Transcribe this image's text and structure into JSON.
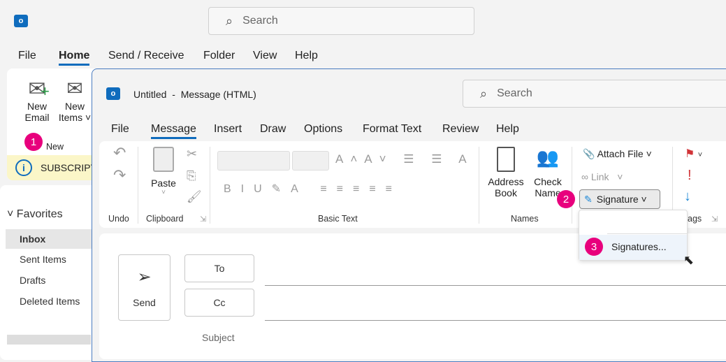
{
  "main": {
    "search_placeholder": "Search",
    "menu": [
      "File",
      "Home",
      "Send / Receive",
      "Folder",
      "View",
      "Help"
    ],
    "ribbon": {
      "new_email": [
        "New",
        "Email"
      ],
      "new_items": [
        "New",
        "Items"
      ],
      "group_new": "New",
      "banner": "SUBSCRIPT"
    },
    "nav": {
      "favorites": "Favorites",
      "items": [
        "Inbox",
        "Sent Items",
        "Drafts",
        "Deleted Items"
      ]
    }
  },
  "compose": {
    "title": "Untitled  -  Message (HTML)",
    "search_placeholder": "Search",
    "tabs": [
      "File",
      "Message",
      "Insert",
      "Draw",
      "Options",
      "Format Text",
      "Review",
      "Help"
    ],
    "active_tab": "Message",
    "groups": {
      "undo": "Undo",
      "clipboard": "Clipboard",
      "basic_text": "Basic Text",
      "names": "Names",
      "tags": "ags"
    },
    "paste": "Paste",
    "address_book": [
      "Address",
      "Book"
    ],
    "check_names": [
      "Check",
      "Name"
    ],
    "attach_file": "Attach File",
    "link": "Link",
    "signature": "Signature",
    "signatures_item": "Signatures...",
    "send": "Send",
    "to": "To",
    "cc": "Cc",
    "subject": "Subject"
  },
  "badges": [
    "1",
    "2",
    "3"
  ],
  "colors": {
    "accent": "#0f6cbd",
    "badge": "#e8007d",
    "banner": "#fbf6c8",
    "flag": "#d13438"
  }
}
